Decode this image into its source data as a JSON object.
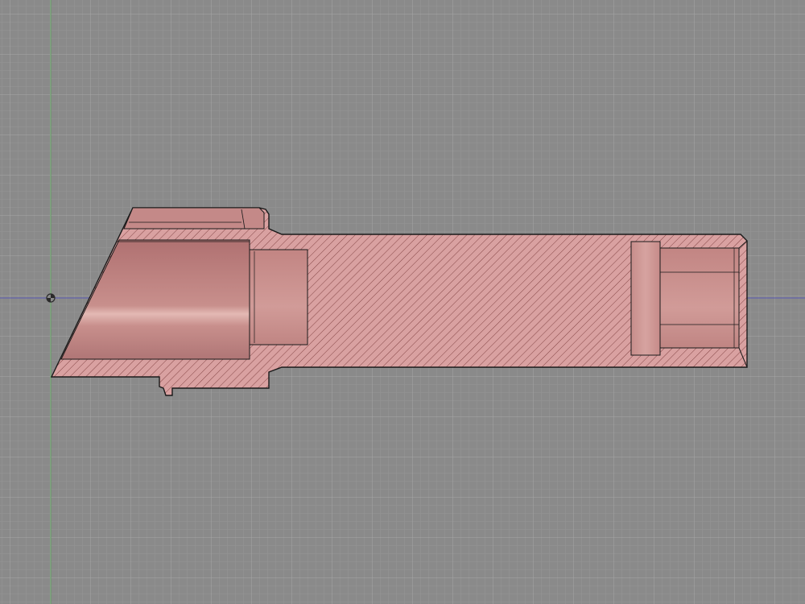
{
  "viewport": {
    "background": "#8a8a8a",
    "grid_minor_color": "#999999",
    "grid_major_color": "#a7a7a7",
    "axis_x_color": "#5a5ab4",
    "axis_y_color": "#5ea05e",
    "origin_icon": "origin-target-icon"
  },
  "part": {
    "view": "section",
    "fill_color": "#d9a1a1",
    "hatch_color": "#7a3a3a",
    "bore_color": "#b97a79",
    "outline_color": "#1a1a1a",
    "features": [
      "chamfered-left-face",
      "top-flange",
      "bottom-lug",
      "left-large-bore",
      "left-counterbore",
      "solid-center-section",
      "right-undercut-groove",
      "right-bore"
    ]
  }
}
